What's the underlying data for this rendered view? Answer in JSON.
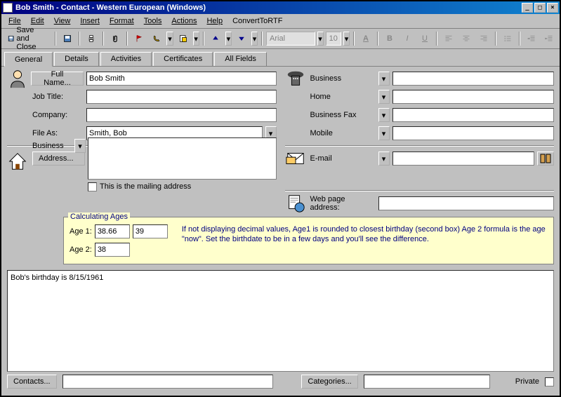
{
  "title": "Bob Smith - Contact   -  Western European (Windows)",
  "menu": [
    "File",
    "Edit",
    "View",
    "Insert",
    "Format",
    "Tools",
    "Actions",
    "Help",
    "ConvertToRTF"
  ],
  "toolbar": {
    "save_close": "Save and Close",
    "font": "Arial",
    "size": "10"
  },
  "tabs": [
    "General",
    "Details",
    "Activities",
    "Certificates",
    "All Fields"
  ],
  "form": {
    "fullname_btn": "Full Name...",
    "fullname_val": "Bob Smith",
    "jobtitle_lbl": "Job Title:",
    "jobtitle_val": "",
    "company_lbl": "Company:",
    "company_val": "",
    "fileas_lbl": "File As:",
    "fileas_val": "Smith, Bob",
    "address_btn": "Address...",
    "address_type": "Business",
    "mailing_chk": "This is the mailing address",
    "phone_business": "Business",
    "phone_home": "Home",
    "phone_bfax": "Business Fax",
    "phone_mobile": "Mobile",
    "email_lbl": "E-mail",
    "web_lbl": "Web page address:"
  },
  "ages_panel": {
    "legend": "Calculating Ages",
    "age1_lbl": "Age 1:",
    "age1_a": "38.66",
    "age1_b": "39",
    "age2_lbl": "Age 2:",
    "age2_val": "38",
    "text": "If not displaying decimal values, Age1 is rounded to closest birthday (second box)  Age 2 formula is the age \"now\". Set the birthdate to be in a few days and you'll see the difference."
  },
  "notes": "Bob's birthday is 8/15/1961",
  "footer": {
    "contacts": "Contacts...",
    "categories": "Categories...",
    "private": "Private"
  }
}
